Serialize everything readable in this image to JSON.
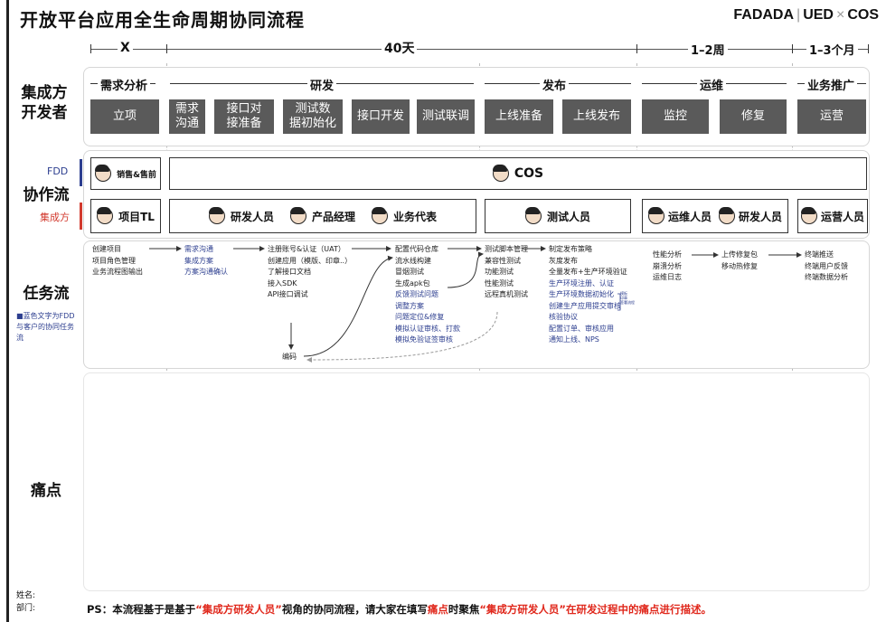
{
  "header": {
    "title": "开放平台应用全生命周期协同流程",
    "brand_left": "FADADA",
    "brand_mid": "UED",
    "brand_x": "×",
    "brand_right": "COS"
  },
  "timeline": {
    "t1": "X",
    "t2": "40天",
    "t3": "1–2周",
    "t4": "1–3个月"
  },
  "rows": {
    "developer": "集成方\n开发者",
    "collab": "协作流",
    "tasks": "任务流",
    "pain": "痛点"
  },
  "collab_tags": {
    "fdd": "FDD",
    "integrator": "集成方"
  },
  "phases": [
    "需求分析",
    "研发",
    "发布",
    "运维",
    "业务推广"
  ],
  "steps": [
    "立项",
    "需求\n沟通",
    "接口对\n接准备",
    "测试数\n据初始化",
    "接口开发",
    "测试联调",
    "上线准备",
    "上线发布",
    "监控",
    "修复",
    "运营"
  ],
  "fdd_roles": {
    "sales": "销售&售前",
    "cos": "COS"
  },
  "roles": [
    "项目TL",
    "研发人员",
    "产品经理",
    "业务代表",
    "测试人员",
    "运维人员",
    "研发人员",
    "运营人员"
  ],
  "task_note": "■蓝色文字为FDD与客户的协同任务流",
  "tasks": {
    "c1": [
      "创建项目",
      "项目角色管理",
      "业务流程图输出"
    ],
    "c2": [
      "需求沟通",
      "集成方案",
      "方案沟通确认"
    ],
    "c3": [
      "注册账号&认证（UAT）",
      "创建应用（模版、印章..）",
      "了解接口文档",
      "接入SDK",
      "API接口调试"
    ],
    "c3_code": "编码",
    "c4_black": [
      "配置代码仓库",
      "流水线构建",
      "冒烟测试",
      "生成apk包"
    ],
    "c4_blue": [
      "反馈测试问题",
      "调整方案",
      "问题定位&修复",
      "模拟认证审核、打款",
      "模拟免验证签审核"
    ],
    "c5": [
      "测试脚本管理",
      "兼容性测试",
      "功能测试",
      "性能测试",
      "远程真机测试"
    ],
    "c6_black": [
      "制定发布策略",
      "灰度发布",
      "全量发布+生产环境验证"
    ],
    "c6_blue": [
      "生产环境注册、认证",
      "生产环境数据初始化",
      "创建生产应用提交审核",
      "核验协议",
      "配置订单、审核应用",
      "通知上线、NPS"
    ],
    "c6_side": "模板\n印章\n签署流程",
    "c7": [
      "性能分析",
      "崩溃分析",
      "运维日志"
    ],
    "c8": [
      "上传修复包",
      "移动热修复"
    ],
    "c9": [
      "终端推送",
      "终端用户反馈",
      "终端数据分析"
    ]
  },
  "footer": {
    "name": "姓名:",
    "dept": "部门:",
    "ps_a": "PS：本流程基于是基于",
    "ps_hl1": "“集成方研发人员”",
    "ps_b": "视角的协同流程，请大家在填写",
    "ps_hl2": "痛点",
    "ps_c": "时聚焦",
    "ps_hl3": "“集成方研发人员”在研发过程中的痛点进行描述。"
  },
  "colors": {
    "step_box": "#5a5a5a",
    "blue_text": "#2c3e8f",
    "fdd_tag": "#2c3e8f",
    "integrator_tag": "#d23a2e",
    "highlight": "#e0281c"
  }
}
